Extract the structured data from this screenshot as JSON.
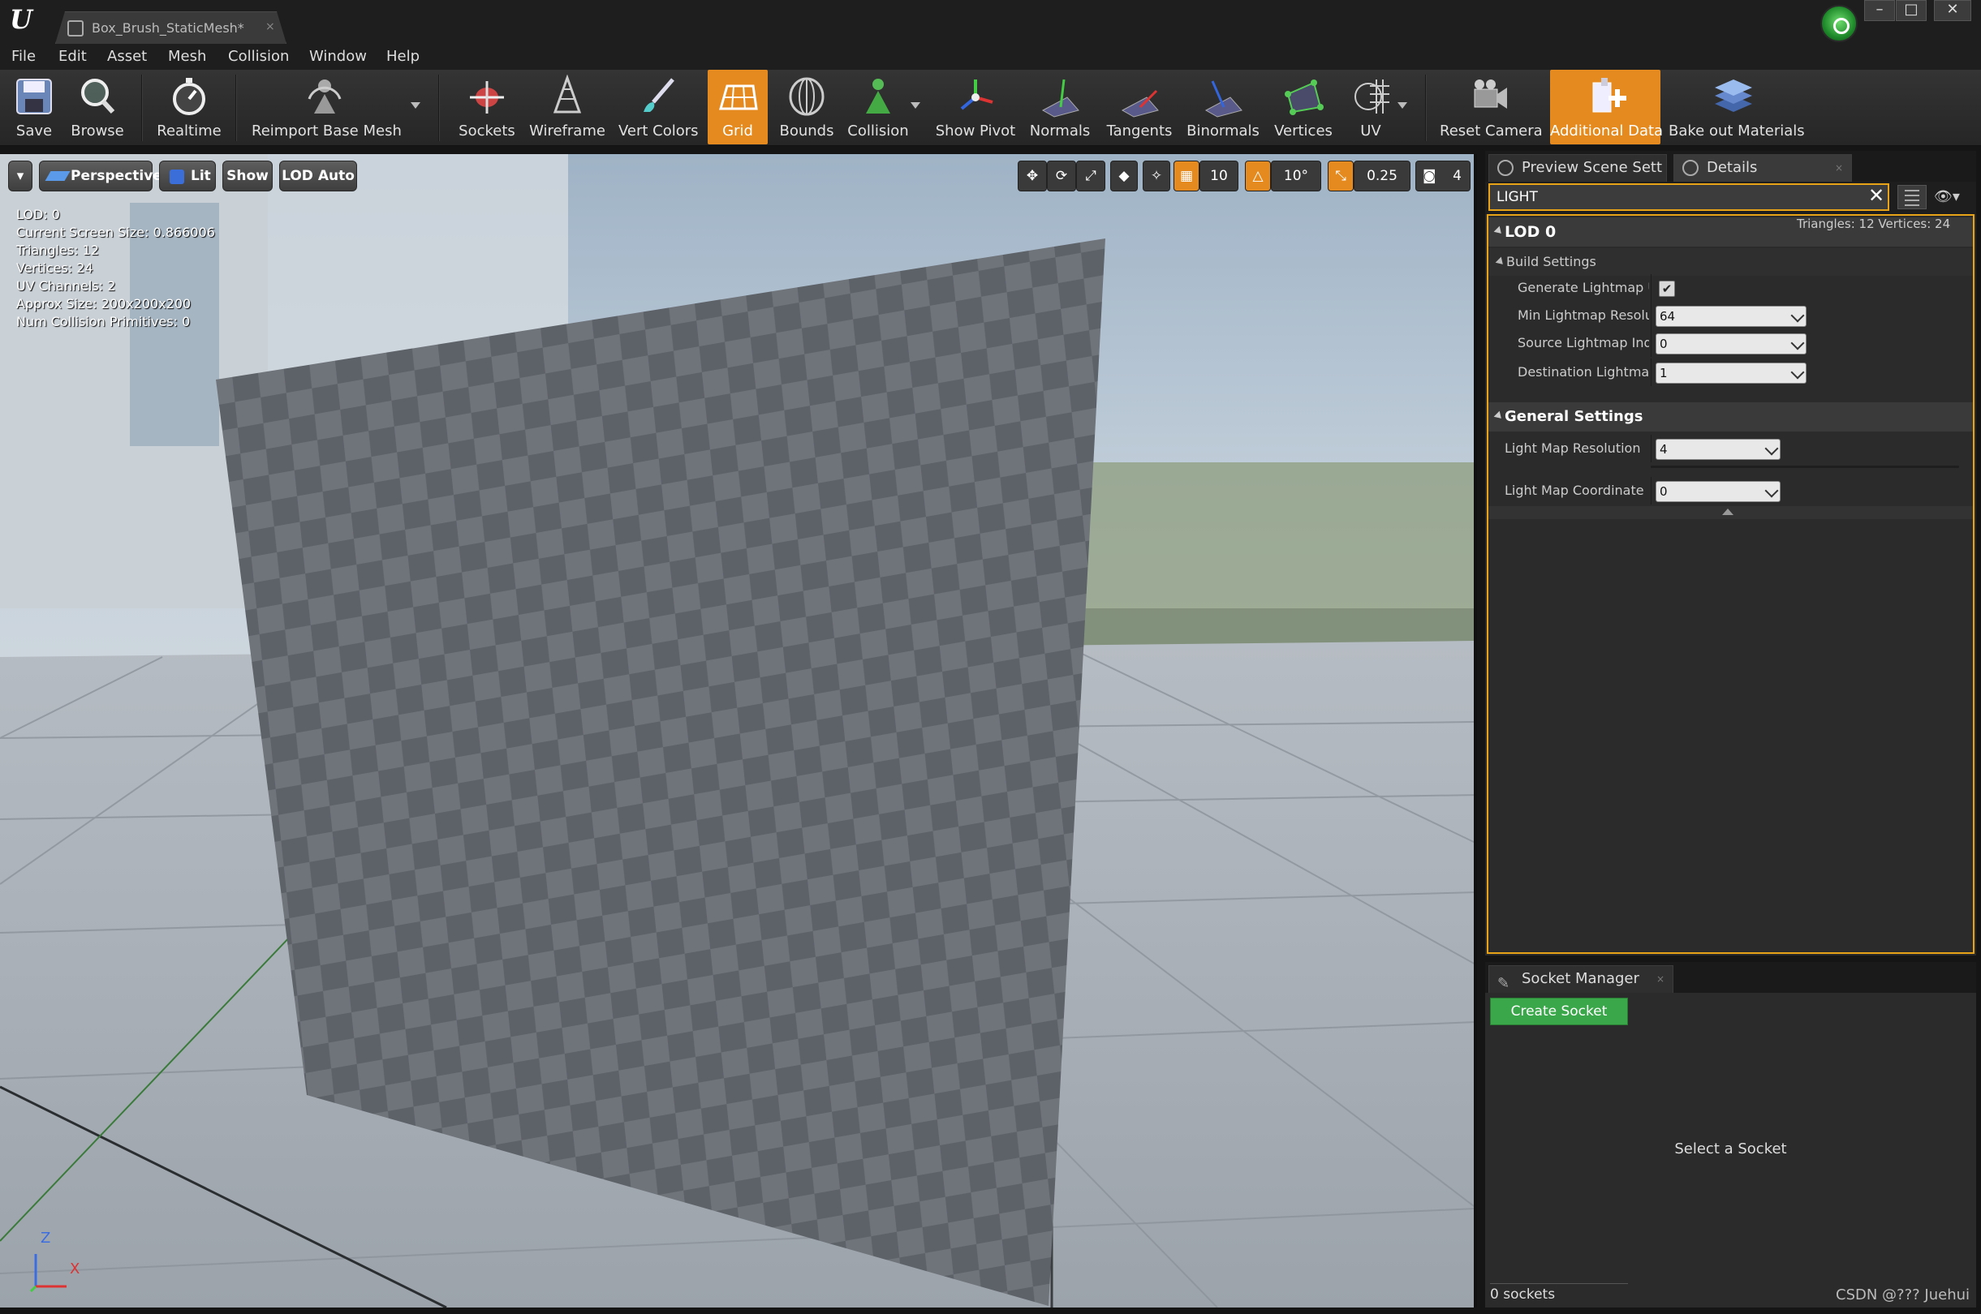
{
  "window": {
    "tab_title": "Box_Brush_StaticMesh*",
    "tab_close": "×",
    "minimize": "–",
    "maximize": "□",
    "close": "✕"
  },
  "menu": [
    "File",
    "Edit",
    "Asset",
    "Mesh",
    "Collision",
    "Window",
    "Help"
  ],
  "toolbar": {
    "save": "Save",
    "browse": "Browse",
    "realtime": "Realtime",
    "reimport": "Reimport Base Mesh",
    "sockets": "Sockets",
    "wireframe": "Wireframe",
    "vert_colors": "Vert Colors",
    "grid": "Grid",
    "bounds": "Bounds",
    "collision": "Collision",
    "show_pivot": "Show Pivot",
    "normals": "Normals",
    "tangents": "Tangents",
    "binormals": "Binormals",
    "vertices": "Vertices",
    "uv": "UV",
    "reset_camera": "Reset Camera",
    "additional_data": "Additional Data",
    "bake_out": "Bake out Materials"
  },
  "viewport": {
    "perspective": "Perspective",
    "lit": "Lit",
    "show": "Show",
    "lod": "LOD Auto",
    "grid_snap": "10",
    "rot_snap": "10°",
    "scale_snap": "0.25",
    "camera_speed": "4",
    "stats": [
      "LOD:  0",
      "Current Screen Size:  0.866006",
      "Triangles:  12",
      "Vertices:  24",
      "UV Channels:  2",
      "Approx Size: 200x200x200",
      "Num Collision Primitives:  0"
    ],
    "axis_z": "Z",
    "axis_x": "X"
  },
  "details": {
    "tab_preview": "Preview Scene Sett",
    "tab_details": "Details",
    "tab_close": "×",
    "search_value": "LIGHT",
    "search_clear": "✕",
    "lod_title": "LOD 0",
    "lod_info": "Triangles: 12   Vertices: 24",
    "build_settings": "Build Settings",
    "gen_lightmap_uv": "Generate Lightmap UV",
    "gen_lightmap_checked": "✔",
    "min_lightmap_res": "Min Lightmap Resoluti",
    "min_lightmap_res_val": "64",
    "src_lightmap_idx": "Source Lightmap Inde:",
    "src_lightmap_idx_val": "0",
    "dst_lightmap_idx": "Destination Lightmap I",
    "dst_lightmap_idx_val": "1",
    "general_settings": "General Settings",
    "light_map_res": "Light Map Resolution",
    "light_map_res_val": "4",
    "light_map_coord": "Light Map Coordinate Inc",
    "light_map_coord_val": "0"
  },
  "socket_manager": {
    "title": "Socket Manager",
    "create": "Create Socket",
    "select": "Select a Socket",
    "count": "0 sockets"
  },
  "watermark": "CSDN @??? Juehui",
  "colors": {
    "accent_orange": "#e58a1f",
    "search_border": "#e8a317",
    "create_green": "#3aa84a"
  }
}
